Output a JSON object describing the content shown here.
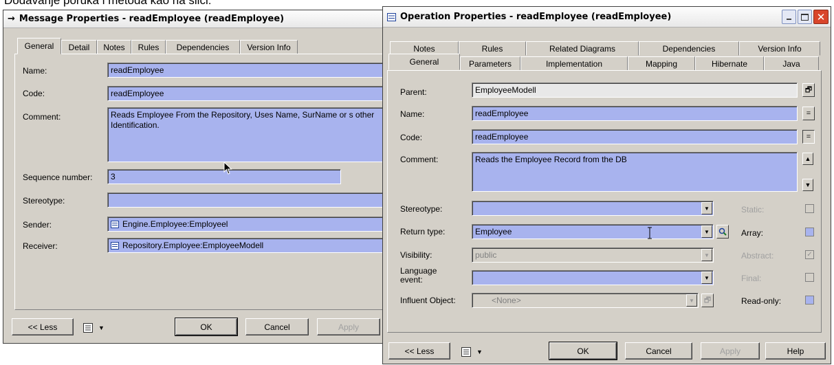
{
  "caption": "Dodavanje poruka i metoda kao na slici:",
  "msg_window": {
    "title": "Message Properties - readEmployee (readEmployee)",
    "tabs": [
      "General",
      "Detail",
      "Notes",
      "Rules",
      "Dependencies",
      "Version Info"
    ],
    "labels": {
      "name": "Name:",
      "code": "Code:",
      "comment": "Comment:",
      "sequence": "Sequence number:",
      "stereotype": "Stereotype:",
      "sender": "Sender:",
      "receiver": "Receiver:"
    },
    "values": {
      "name": "readEmployee",
      "code": "readEmployee",
      "comment": "Reads Employee From the Repository, Uses Name, SurName or s other Identification.",
      "sequence": "3",
      "stereotype": "",
      "sender": "Engine.Employee:Employeel",
      "receiver": "Repository.Employee:EmployeeModell"
    },
    "buttons": {
      "less": "<< Less",
      "ok": "OK",
      "cancel": "Cancel",
      "apply": "Apply"
    }
  },
  "op_window": {
    "title": "Operation Properties - readEmployee (readEmployee)",
    "tabs_row1": [
      "Notes",
      "Rules",
      "Related Diagrams",
      "Dependencies",
      "Version Info"
    ],
    "tabs_row2": [
      "General",
      "Parameters",
      "Implementation",
      "Mapping",
      "Hibernate",
      "Java"
    ],
    "labels": {
      "parent": "Parent:",
      "name": "Name:",
      "code": "Code:",
      "comment": "Comment:",
      "stereotype": "Stereotype:",
      "return_type": "Return type:",
      "visibility": "Visibility:",
      "language_event": "Language event:",
      "influent": "Influent Object:",
      "static": "Static:",
      "array": "Array:",
      "abstract": "Abstract:",
      "final": "Final:",
      "readonly": "Read-only:"
    },
    "values": {
      "parent": "EmployeeModell",
      "name": "readEmployee",
      "code": "readEmployee",
      "comment": "Reads the Employee Record from the DB",
      "stereotype": "",
      "return_type": "Employee",
      "visibility": "public",
      "language_event": "",
      "influent": "<None>"
    },
    "buttons": {
      "less": "<< Less",
      "ok": "OK",
      "cancel": "Cancel",
      "apply": "Apply",
      "help": "Help"
    }
  },
  "colors": {
    "field_blue": "#a8b3ee",
    "dialog_gray": "#d4d0c8",
    "close_red": "#d9452b"
  }
}
